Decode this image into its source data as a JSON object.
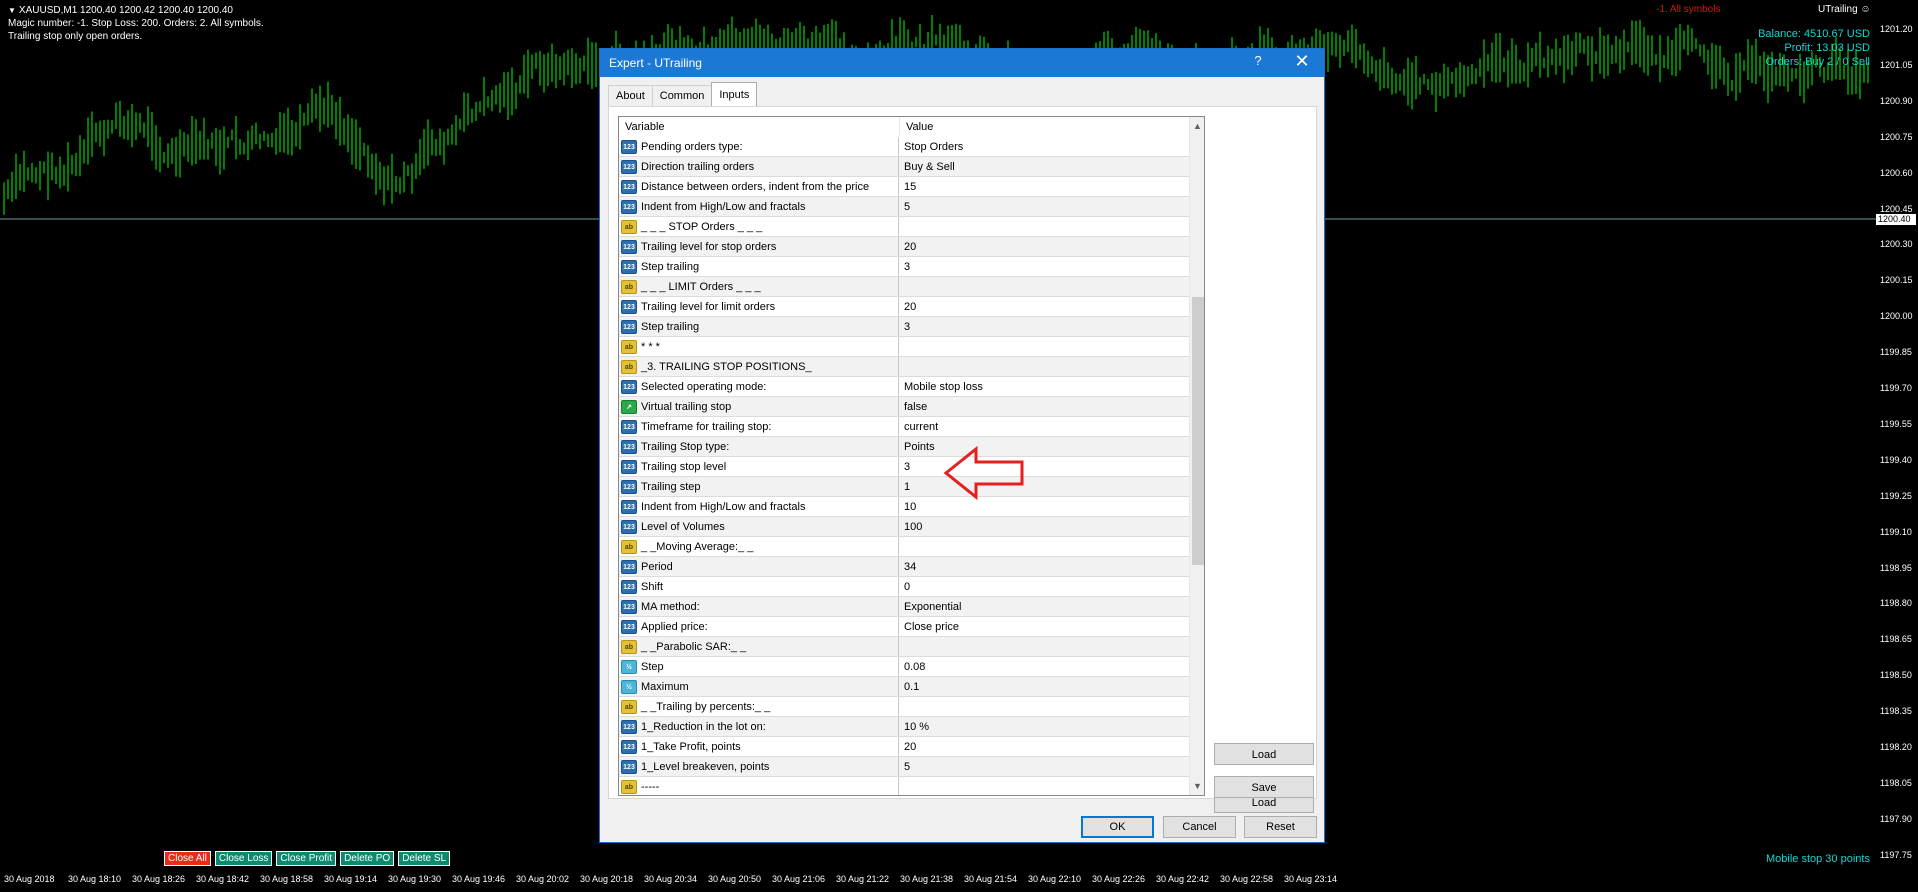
{
  "chart": {
    "info_line1": "XAUUSD,M1  1200.40 1200.42 1200.40 1200.40",
    "info_line2": "Magic number: -1. Stop Loss: 200. Orders: 2. All symbols.",
    "info_line3": "Trailing stop only open orders.",
    "red_note": "-1. All symbols",
    "ea_name": "UTrailing",
    "balance": "Balance: 4510.67 USD",
    "profit": "Profit: 13.03 USD",
    "orders": "Orders: Buy 2 / 0 Sell",
    "mobile_stop": "Mobile stop 30 points",
    "current_price": "1200.40",
    "price_ticks": [
      "1201.20",
      "1201.05",
      "1200.90",
      "1200.75",
      "1200.60",
      "1200.45",
      "1200.30",
      "1200.15",
      "1200.00",
      "1199.85",
      "1199.70",
      "1199.55",
      "1199.40",
      "1199.25",
      "1199.10",
      "1198.95",
      "1198.80",
      "1198.65",
      "1198.50",
      "1198.35",
      "1198.20",
      "1198.05",
      "1197.90",
      "1197.75"
    ],
    "time_ticks": [
      "30 Aug 2018",
      "30 Aug 18:10",
      "30 Aug 18:26",
      "30 Aug 18:42",
      "30 Aug 18:58",
      "30 Aug 19:14",
      "30 Aug 19:30",
      "30 Aug 19:46",
      "30 Aug 20:02",
      "30 Aug 20:18",
      "30 Aug 20:34",
      "30 Aug 20:50",
      "30 Aug 21:06",
      "30 Aug 21:22",
      "30 Aug 21:38",
      "30 Aug 21:54",
      "30 Aug 22:10",
      "30 Aug 22:26",
      "30 Aug 22:42",
      "30 Aug 22:58",
      "30 Aug 23:14"
    ],
    "buttons": {
      "close_all": "Close All",
      "close_loss": "Close Loss",
      "close_profit": "Close Profit",
      "delete_po": "Delete PO",
      "delete_sl": "Delete SL"
    },
    "colors": {
      "candles": "#00ff00",
      "accent": "#19d4d4",
      "alert": "#e01010"
    }
  },
  "dialog": {
    "title": "Expert - UTrailing",
    "help": "?",
    "close": "✕",
    "tabs": [
      "About",
      "Common",
      "Inputs"
    ],
    "active_tab": "Inputs",
    "columns": {
      "variable": "Variable",
      "value": "Value"
    },
    "rows": [
      {
        "icon": "num",
        "var": "Pending orders type:",
        "val": "Stop Orders"
      },
      {
        "icon": "num",
        "var": "Direction trailing orders",
        "val": "Buy & Sell"
      },
      {
        "icon": "num",
        "var": "Distance between orders, indent from the price",
        "val": "15"
      },
      {
        "icon": "num",
        "var": "Indent from High/Low and fractals",
        "val": "5"
      },
      {
        "icon": "ab",
        "var": "_ _ _ STOP Orders _ _ _",
        "val": ""
      },
      {
        "icon": "num",
        "var": "Trailing level for stop orders",
        "val": "20"
      },
      {
        "icon": "num",
        "var": "Step trailing",
        "val": "3"
      },
      {
        "icon": "ab",
        "var": "_ _ _ LIMIT Orders _ _ _",
        "val": ""
      },
      {
        "icon": "num",
        "var": "Trailing level for limit orders",
        "val": "20"
      },
      {
        "icon": "num",
        "var": "Step trailing",
        "val": "3"
      },
      {
        "icon": "ab",
        "var": "* * *",
        "val": ""
      },
      {
        "icon": "ab",
        "var": "_3. TRAILING STOP POSITIONS_",
        "val": ""
      },
      {
        "icon": "num",
        "var": "Selected operating mode:",
        "val": "Mobile stop loss"
      },
      {
        "icon": "bool",
        "var": "Virtual trailing stop",
        "val": "false"
      },
      {
        "icon": "num",
        "var": "Timeframe for trailing stop:",
        "val": "current"
      },
      {
        "icon": "num",
        "var": "Trailing Stop type:",
        "val": "Points"
      },
      {
        "icon": "num",
        "var": "Trailing stop level",
        "val": "3"
      },
      {
        "icon": "num",
        "var": "Trailing step",
        "val": "1"
      },
      {
        "icon": "num",
        "var": "Indent from High/Low and fractals",
        "val": "10"
      },
      {
        "icon": "num",
        "var": "Level of Volumes",
        "val": "100"
      },
      {
        "icon": "ab",
        "var": "_ _Moving Average:_ _",
        "val": ""
      },
      {
        "icon": "num",
        "var": "Period",
        "val": "34"
      },
      {
        "icon": "num",
        "var": "Shift",
        "val": "0"
      },
      {
        "icon": "num",
        "var": "MA method:",
        "val": "Exponential"
      },
      {
        "icon": "num",
        "var": "Applied price:",
        "val": "Close price"
      },
      {
        "icon": "ab",
        "var": "_ _Parabolic SAR:_ _",
        "val": ""
      },
      {
        "icon": "dbl",
        "var": "Step",
        "val": "0.08"
      },
      {
        "icon": "dbl",
        "var": "Maximum",
        "val": "0.1"
      },
      {
        "icon": "ab",
        "var": "_ _Trailing by percents:_ _",
        "val": ""
      },
      {
        "icon": "num",
        "var": "1_Reduction in the lot on:",
        "val": "10 %"
      },
      {
        "icon": "num",
        "var": "1_Take Profit, points",
        "val": "20"
      },
      {
        "icon": "num",
        "var": "1_Level breakeven, points",
        "val": "5"
      },
      {
        "icon": "ab",
        "var": "-----",
        "val": ""
      }
    ],
    "load": "Load",
    "save": "Save",
    "ok": "OK",
    "cancel": "Cancel",
    "reset": "Reset"
  }
}
